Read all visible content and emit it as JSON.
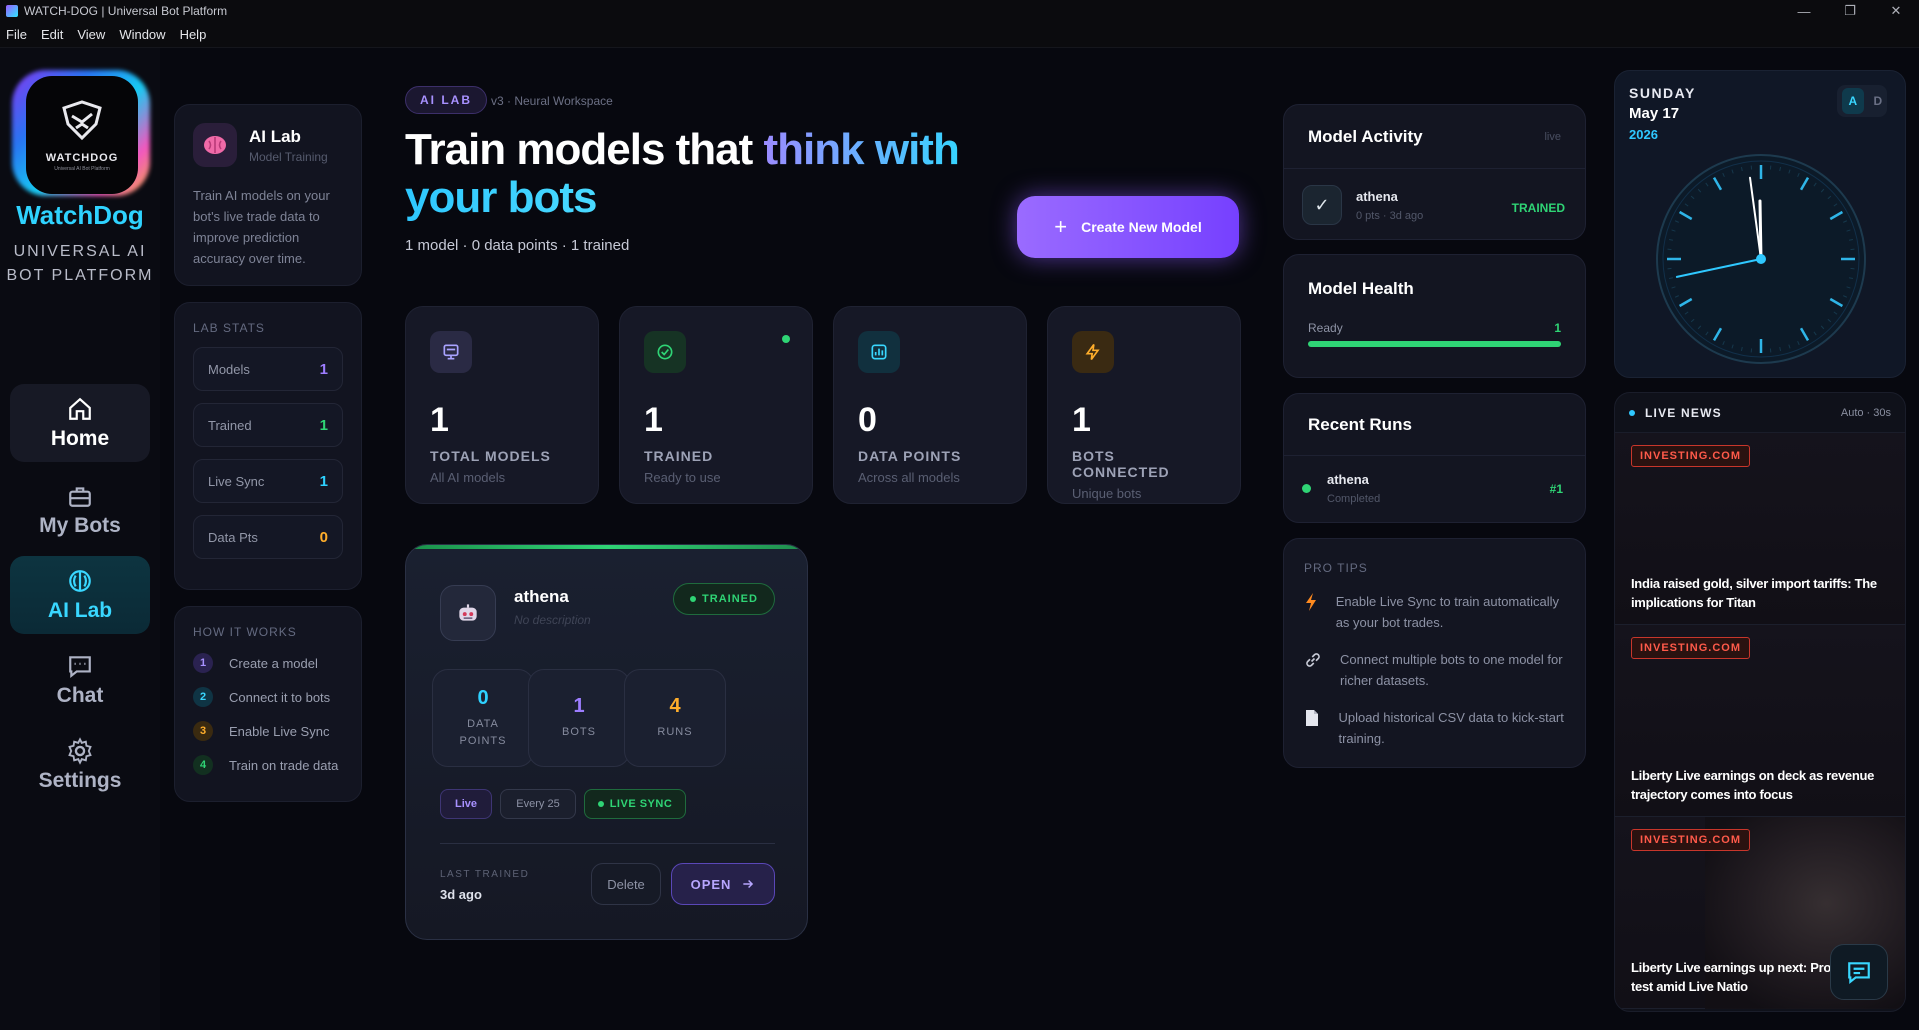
{
  "window": {
    "title": "WATCH-DOG | Universal Bot Platform",
    "controls": [
      "—",
      "❐",
      "✕"
    ]
  },
  "menu": [
    "File",
    "Edit",
    "View",
    "Window",
    "Help"
  ],
  "sidebar": {
    "logo_text": "WATCHDOG",
    "logo_tagline": "Universal AI Bot Platform",
    "brand": "WatchDog",
    "subtitle_line1": "UNIVERSAL AI",
    "subtitle_line2": "BOT PLATFORM",
    "nav": [
      {
        "label": "Home",
        "icon": "home-icon"
      },
      {
        "label": "My Bots",
        "icon": "briefcase-icon"
      },
      {
        "label": "AI Lab",
        "icon": "brain-icon"
      },
      {
        "label": "Chat",
        "icon": "chat-icon"
      },
      {
        "label": "Settings",
        "icon": "gear-icon"
      }
    ]
  },
  "lab": {
    "title": "AI Lab",
    "subtitle": "Model Training",
    "description": "Train AI models on your bot's live trade data to improve prediction accuracy over time."
  },
  "lab_stats": {
    "label": "LAB STATS",
    "rows": [
      {
        "name": "Models",
        "value": "1"
      },
      {
        "name": "Trained",
        "value": "1"
      },
      {
        "name": "Live Sync",
        "value": "1"
      },
      {
        "name": "Data Pts",
        "value": "0"
      }
    ]
  },
  "how": {
    "label": "HOW IT WORKS",
    "steps": [
      {
        "num": "1",
        "text": "Create a model"
      },
      {
        "num": "2",
        "text": "Connect it to bots"
      },
      {
        "num": "3",
        "text": "Enable Live Sync"
      },
      {
        "num": "4",
        "text": "Train on trade data"
      }
    ]
  },
  "header": {
    "badge": "AI LAB",
    "version": "v3 · Neural Workspace",
    "title_plain": "Train models that ",
    "title_grad1": "think with",
    "title_grad2": "your bots",
    "summary": "1 model · 0 data points · 1 trained",
    "create_label": "Create New Model"
  },
  "metrics": [
    {
      "value": "1",
      "label": "TOTAL MODELS",
      "sub": "All AI models",
      "icon": "monitor-icon"
    },
    {
      "value": "1",
      "label": "TRAINED",
      "sub": "Ready to use",
      "icon": "check-circle-icon"
    },
    {
      "value": "0",
      "label": "DATA POINTS",
      "sub": "Across all models",
      "icon": "bar-chart-icon"
    },
    {
      "value": "1",
      "label": "BOTS CONNECTED",
      "sub": "Unique bots",
      "icon": "lightning-icon"
    }
  ],
  "model": {
    "name": "athena",
    "description": "No description",
    "status": "TRAINED",
    "stats": [
      {
        "value": "0",
        "label_line1": "DATA",
        "label_line2": "POINTS"
      },
      {
        "value": "1",
        "label_line1": "BOTS",
        "label_line2": ""
      },
      {
        "value": "4",
        "label_line1": "RUNS",
        "label_line2": ""
      }
    ],
    "chip_live": "Live",
    "chip_every": "Every 25",
    "chip_sync": "LIVE SYNC",
    "last_trained_label": "LAST TRAINED",
    "last_trained_value": "3d ago",
    "delete_label": "Delete",
    "open_label": "OPEN"
  },
  "activity": {
    "title": "Model Activity",
    "live": "live",
    "item_name": "athena",
    "item_meta": "0 pts · 3d ago",
    "item_status": "TRAINED"
  },
  "health": {
    "title": "Model Health",
    "label": "Ready",
    "value": "1",
    "fraction": 1.0
  },
  "runs": {
    "title": "Recent Runs",
    "item_name": "athena",
    "item_status": "Completed",
    "item_rank": "#1"
  },
  "tips": {
    "label": "PRO TIPS",
    "items": [
      {
        "icon": "lightning-icon",
        "text": "Enable Live Sync to train automatically as your bot trades."
      },
      {
        "icon": "link-icon",
        "text": "Connect multiple bots to one model for richer datasets."
      },
      {
        "icon": "file-icon",
        "text": "Upload historical CSV data to kick-start training."
      }
    ]
  },
  "clock": {
    "day": "SUNDAY",
    "date": "May 17",
    "year": "2026",
    "mode_a": "A",
    "mode_d": "D",
    "hours": 11,
    "minutes": 58,
    "seconds": 43
  },
  "news": {
    "title": "LIVE NEWS",
    "auto": "Auto · 30s",
    "items": [
      {
        "source": "INVESTING.COM",
        "headline": "India raised gold, silver import tariffs: The implications for Titan"
      },
      {
        "source": "INVESTING.COM",
        "headline": "Liberty Live earnings on deck as revenue trajectory comes into focus"
      },
      {
        "source": "INVESTING.COM",
        "headline": "Liberty Live earnings up next: Profitability test amid Live Natio"
      }
    ]
  },
  "colors": {
    "accent_cyan": "#2fd3ff",
    "accent_purple": "#9d7dff",
    "success": "#2fd475",
    "warning": "#ffae2b",
    "news_red": "#ff5a4a"
  }
}
